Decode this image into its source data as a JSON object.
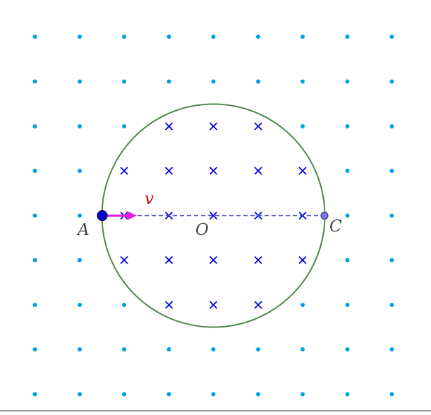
{
  "diagram": {
    "labels": {
      "start_point": "A",
      "center": "O",
      "end_point": "C",
      "velocity": "v"
    },
    "field_outside": "dots",
    "field_inside": "crosses",
    "colors": {
      "background": "#ffffff",
      "dot": "#00a0e6",
      "cross": "#0000e0",
      "circle": "#4a8a4a",
      "diameter": "#4848d8",
      "velocity_arrow": "#e020e0",
      "velocity_label": "#cc0000",
      "point_A": "#0000cc",
      "point_C": "#7a7ae6",
      "label_text": "#444444"
    }
  }
}
